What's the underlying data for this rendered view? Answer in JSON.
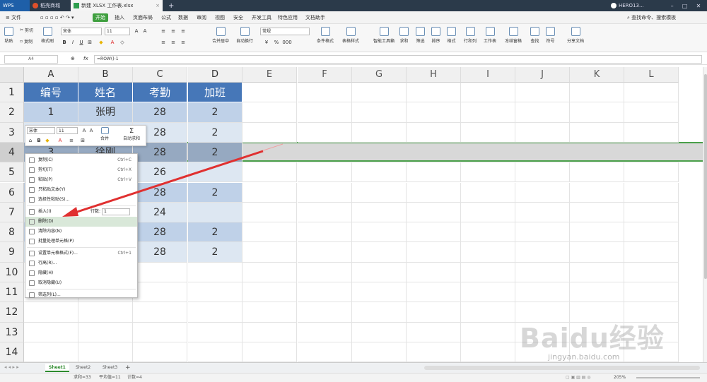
{
  "tabs": {
    "wps": "WPS",
    "store": "稻壳商城",
    "file": "新建 XLSX 工作表.xlsx",
    "add": "+",
    "user": "HERO13..."
  },
  "menu": {
    "file": "文件",
    "items": [
      "开始",
      "插入",
      "页面布局",
      "公式",
      "数据",
      "审阅",
      "视图",
      "安全",
      "开发工具",
      "特色应用",
      "文档助手"
    ],
    "search": "查找命令、搜索模板"
  },
  "ribbon": {
    "paste": "粘贴",
    "cut": "剪切",
    "copy": "复制",
    "format_painter": "格式刷",
    "font": "宋体",
    "size": "11",
    "merge": "合并居中",
    "wrap": "自动换行",
    "number_format": "常规",
    "cond": "条件格式",
    "table_style": "表格样式",
    "smart": "智能工具箱",
    "sum": "求和",
    "filter": "筛选",
    "sort": "排序",
    "format": "格式",
    "rowcol": "行和列",
    "sheet": "工作表",
    "freeze": "冻结窗格",
    "find": "查找",
    "symbol": "符号",
    "share": "分享文档",
    "pct": "%",
    "k000": "000"
  },
  "formula": {
    "name": "A4",
    "fx": "fx",
    "value": "=ROW()-1"
  },
  "columns": [
    "A",
    "B",
    "C",
    "D",
    "E",
    "F",
    "G",
    "H",
    "I",
    "J",
    "K",
    "L"
  ],
  "rows": [
    "1",
    "2",
    "3",
    "4",
    "5",
    "6",
    "7",
    "8",
    "9",
    "10",
    "11",
    "12",
    "13",
    "14"
  ],
  "table": {
    "headers": [
      "编号",
      "姓名",
      "考勤",
      "加班"
    ],
    "data": [
      [
        "1",
        "张明",
        "28",
        "2"
      ],
      [
        "2",
        "",
        "28",
        "2"
      ],
      [
        "3",
        "徐刚",
        "28",
        "2"
      ],
      [
        "",
        "",
        "26",
        ""
      ],
      [
        "",
        "",
        "28",
        "2"
      ],
      [
        "",
        "",
        "24",
        ""
      ],
      [
        "",
        "",
        "28",
        "2"
      ],
      [
        "",
        "",
        "28",
        "2"
      ]
    ]
  },
  "minitoolbar": {
    "font": "宋体",
    "size": "11",
    "merge": "合并",
    "autosum": "自动求和"
  },
  "context_menu": {
    "items": [
      {
        "label": "复制(C)",
        "shortcut": "Ctrl+C"
      },
      {
        "label": "剪切(T)",
        "shortcut": "Ctrl+X"
      },
      {
        "label": "粘贴(P)",
        "shortcut": "Ctrl+V"
      },
      {
        "label": "只粘贴文本(Y)",
        "shortcut": ""
      },
      {
        "label": "选择性粘贴(S)...",
        "shortcut": ""
      },
      {
        "label": "插入(I)",
        "shortcut": ""
      },
      {
        "label": "删除(D)",
        "shortcut": ""
      },
      {
        "label": "清除内容(N)",
        "shortcut": ""
      },
      {
        "label": "批量处理单元格(P)",
        "shortcut": ""
      },
      {
        "label": "设置单元格格式(F)...",
        "shortcut": "Ctrl+1"
      },
      {
        "label": "行高(R)...",
        "shortcut": ""
      },
      {
        "label": "隐藏(H)",
        "shortcut": ""
      },
      {
        "label": "取消隐藏(U)",
        "shortcut": ""
      },
      {
        "label": "筛选列(L)...",
        "shortcut": ""
      }
    ],
    "insert_rows_label": "行数:",
    "insert_rows_value": "1"
  },
  "sheets": [
    "Sheet1",
    "Sheet2",
    "Sheet3"
  ],
  "status": {
    "sum": "求和=33",
    "avg": "平均值=11",
    "count": "计数=4",
    "zoom": "205%"
  },
  "watermark": {
    "brand": "Baidu经验",
    "url": "jingyan.baidu.com"
  },
  "colors": {
    "header": "#4677b8",
    "accent": "#3f9f3f",
    "arrow": "#e03030"
  }
}
